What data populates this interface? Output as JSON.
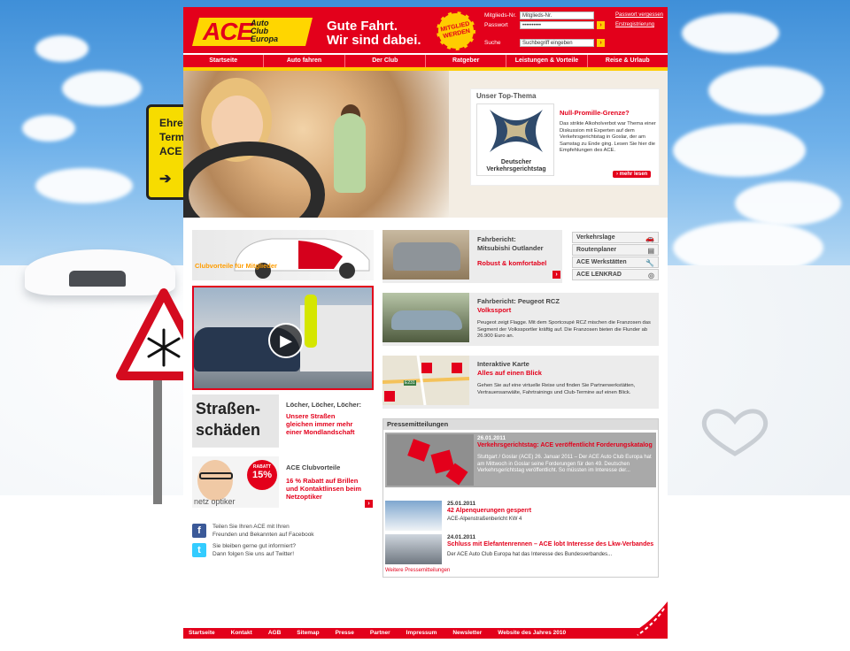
{
  "brand": {
    "logo_text": "ACE",
    "logo_subtitle": [
      "Auto",
      "Club",
      "Europa"
    ],
    "slogan_line1": "Gute Fahrt.",
    "slogan_line2": "Wir sind dabei.",
    "badge_line1": "MITGLIED",
    "badge_line2": "WERDEN",
    "red": "#e3001b",
    "yellow": "#ffd600"
  },
  "login": {
    "member_label": "Mitglieds-Nr.",
    "member_value": "Mitglieds-Nr.",
    "password_label": "Passwort",
    "password_value": "••••••••••",
    "search_label": "Suche",
    "search_value": "Suchbegriff eingeben",
    "forgot_link": "Passwort vergessen",
    "register_link": "Erstregistrierung",
    "go": "›"
  },
  "nav": {
    "items": [
      "Startseite",
      "Auto fahren",
      "Der Club",
      "Ratgeber",
      "Leistungen & Vorteile",
      "Reise & Urlaub"
    ]
  },
  "sign": {
    "lines": [
      "Ehre",
      "Term",
      "ACE"
    ],
    "arrow": "➔"
  },
  "top_theme": {
    "title": "Unser Top-Thema",
    "logo_line1": "Deutscher",
    "logo_line2": "Verkehrsgerichtstag",
    "headline": "Null-Promille-Grenze?",
    "text": "Das strikte Alkoholverbot war Thema einer Diskussion mit Experten auf dem Verkehrsgerichtstag in Goslar, der am Samstag zu Ende ging. Lesen Sie hier die Empfehlungen des ACE.",
    "more": "› mehr lesen"
  },
  "left_col": {
    "clubvorteile_banner": "Clubvorteile für Mitglieder",
    "roads_title": "Löcher, Löcher, Löcher:",
    "roads_red": [
      "Unsere Straßen",
      "gleichen immer mehr",
      "einer Mondlandschaft"
    ],
    "roads_img_line1": "Straßen-",
    "roads_img_line2": "schäden",
    "club_title": "ACE Clubvorteile",
    "club_red": [
      "16 % Rabatt auf Brillen",
      "und Kontaktlinsen beim",
      "Netzoptiker"
    ],
    "badge_top": "RABATT",
    "badge_pct": "15%",
    "netzoptiker": "netz optiker",
    "arrow": "›"
  },
  "social": {
    "fb_text": [
      "Teilen Sie Ihren ACE mit Ihren",
      "Freunden und Bekannten auf Facebook"
    ],
    "tw_text": [
      "Sie bleiben gerne gut informiert?",
      "Dann folgen Sie uns auf Twitter!"
    ],
    "fb_icon": "f",
    "tw_icon": "t"
  },
  "mid_col": {
    "outlander_title": "Fahrbericht:",
    "outlander_title2": "Mitsubishi Outlander",
    "outlander_red": "Robust & komfortabel",
    "rcz_title": "Fahrbericht: Peugeot RCZ",
    "rcz_red": "Volkssport",
    "rcz_text": "Peugeot zeigt Flagge. Mit dem Sportcoupé RCZ mischen die Franzosen das Segment der Volkssportler kräftig auf. Die Franzosen bieten die Flunder ab 26.900 Euro an.",
    "map_title": "Interaktive Karte",
    "map_red": "Alles auf einen Blick",
    "map_text": "Gehen Sie auf eine virtuelle Reise und finden Sie Partnerwerkstätten, Vertrauensanwälte, Fahrtrainings und Club-Termine auf einen Blick.",
    "map_labels": [
      "E231",
      "F",
      "S"
    ]
  },
  "quick_links": [
    {
      "label": "Verkehrslage",
      "icon": "🚗"
    },
    {
      "label": "Routenplaner",
      "icon": "▤"
    },
    {
      "label": "ACE Werkstätten",
      "icon": "🔧"
    },
    {
      "label": "ACE LENKRAD",
      "icon": "◎"
    }
  ],
  "press": {
    "header": "Pressemitteilungen",
    "items": [
      {
        "date": "26.01.2011",
        "title": "Verkehrsgerichtstag: ACE veröffentlicht Forderungskatalog",
        "text": "Stuttgart / Goslar (ACE) 26. Januar 2011 – Der ACE Auto Club Europa hat am Mittwoch in Goslar seine Forderungen für den 49. Deutschen Verkehrsgerichtstag veröffentlicht. So müssten im Interesse der..."
      },
      {
        "date": "25.01.2011",
        "title": "42 Alpenquerungen gesperrt",
        "text": "ACE-Alpenstraßenbericht KW 4"
      },
      {
        "date": "24.01.2011",
        "title": "Schluss mit Elefantenrennen – ACE lobt Interesse des Lkw-Verbandes",
        "text": "Der ACE Auto Club Europa hat das Interesse des Bundesverbandes..."
      }
    ],
    "more_link": "Weitere Pressemitteilungen"
  },
  "footer": {
    "items": [
      "Startseite",
      "Kontakt",
      "AGB",
      "Sitemap",
      "Presse",
      "Partner",
      "Impressum",
      "Newsletter",
      "Website des Jahres 2010"
    ]
  }
}
